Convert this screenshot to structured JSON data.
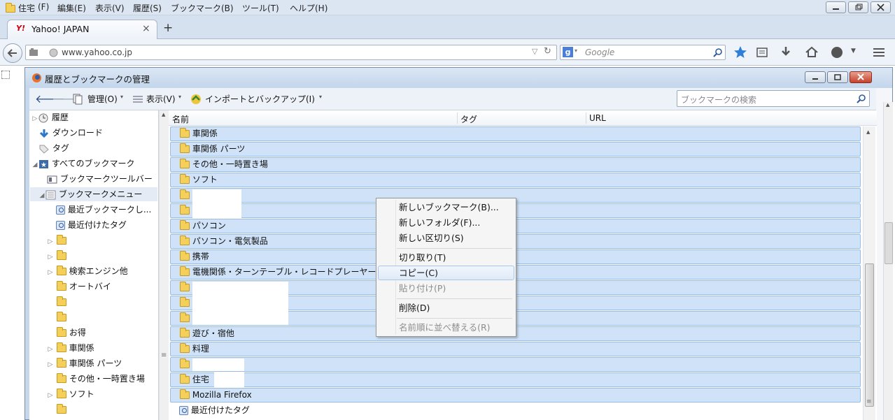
{
  "menubar": {
    "title": "住宅",
    "items": [
      "(F)",
      "編集(E)",
      "表示(V)",
      "履歴(S)",
      "ブックマーク(B)",
      "ツール(T)",
      "ヘルプ(H)"
    ]
  },
  "tab": {
    "label": "Yahoo! JAPAN",
    "close": "×",
    "new_tab": "+"
  },
  "nav": {
    "url": "www.yahoo.co.jp",
    "search_placeholder": "Google"
  },
  "library": {
    "title": "履歴とブックマークの管理",
    "toolbar": {
      "organize": "管理(O)",
      "views": "表示(V)",
      "import": "インポートとバックアップ(I)"
    },
    "search_placeholder": "ブックマークの検索",
    "tree": [
      {
        "label": "履歴"
      },
      {
        "label": "ダウンロード"
      },
      {
        "label": "タグ"
      },
      {
        "label": "すべてのブックマーク"
      },
      {
        "label": "ブックマークツールバー"
      },
      {
        "label": "ブックマークメニュー"
      },
      {
        "label": "最近ブックマークし..."
      },
      {
        "label": "最近付けたタグ"
      },
      {
        "label": ""
      },
      {
        "label": ""
      },
      {
        "label": "検索エンジン他"
      },
      {
        "label": "オートバイ"
      },
      {
        "label": ""
      },
      {
        "label": ""
      },
      {
        "label": "お得"
      },
      {
        "label": "車関係"
      },
      {
        "label": "車関係 パーツ"
      },
      {
        "label": "その他・一時置き場"
      },
      {
        "label": "ソフト"
      },
      {
        "label": ""
      }
    ],
    "columns": {
      "name": "名前",
      "tags": "タグ",
      "url": "URL"
    },
    "rows": [
      {
        "name": "車関係"
      },
      {
        "name": "車関係 パーツ"
      },
      {
        "name": "その他・一時置き場"
      },
      {
        "name": "ソフト"
      },
      {
        "name": ""
      },
      {
        "name": ""
      },
      {
        "name": "パソコン"
      },
      {
        "name": "パソコン・電気製品"
      },
      {
        "name": "携帯"
      },
      {
        "name": "電機関係・ターンテーブル・レコードプレーヤー"
      },
      {
        "name": ""
      },
      {
        "name": ""
      },
      {
        "name": ""
      },
      {
        "name": "遊び・宿他"
      },
      {
        "name": "料理"
      },
      {
        "name": ""
      },
      {
        "name": "住宅"
      },
      {
        "name": "Mozilla Firefox"
      },
      {
        "name": "最近付けたタグ"
      }
    ]
  },
  "context_menu": {
    "items": [
      {
        "label": "新しいブックマーク(B)...",
        "disabled": false
      },
      {
        "label": "新しいフォルダ(F)...",
        "disabled": false
      },
      {
        "label": "新しい区切り(S)",
        "disabled": false
      },
      {
        "label": "切り取り(T)",
        "disabled": false
      },
      {
        "label": "コピー(C)",
        "disabled": false
      },
      {
        "label": "貼り付け(P)",
        "disabled": true
      },
      {
        "label": "削除(D)",
        "disabled": false
      },
      {
        "label": "名前順に並べ替える(R)",
        "disabled": true
      }
    ]
  },
  "colors": {
    "selection": "#cfe2f7",
    "selection_border": "#98bde6",
    "folder": "#f4cf5a",
    "window_frame": "#c7d8ec"
  }
}
